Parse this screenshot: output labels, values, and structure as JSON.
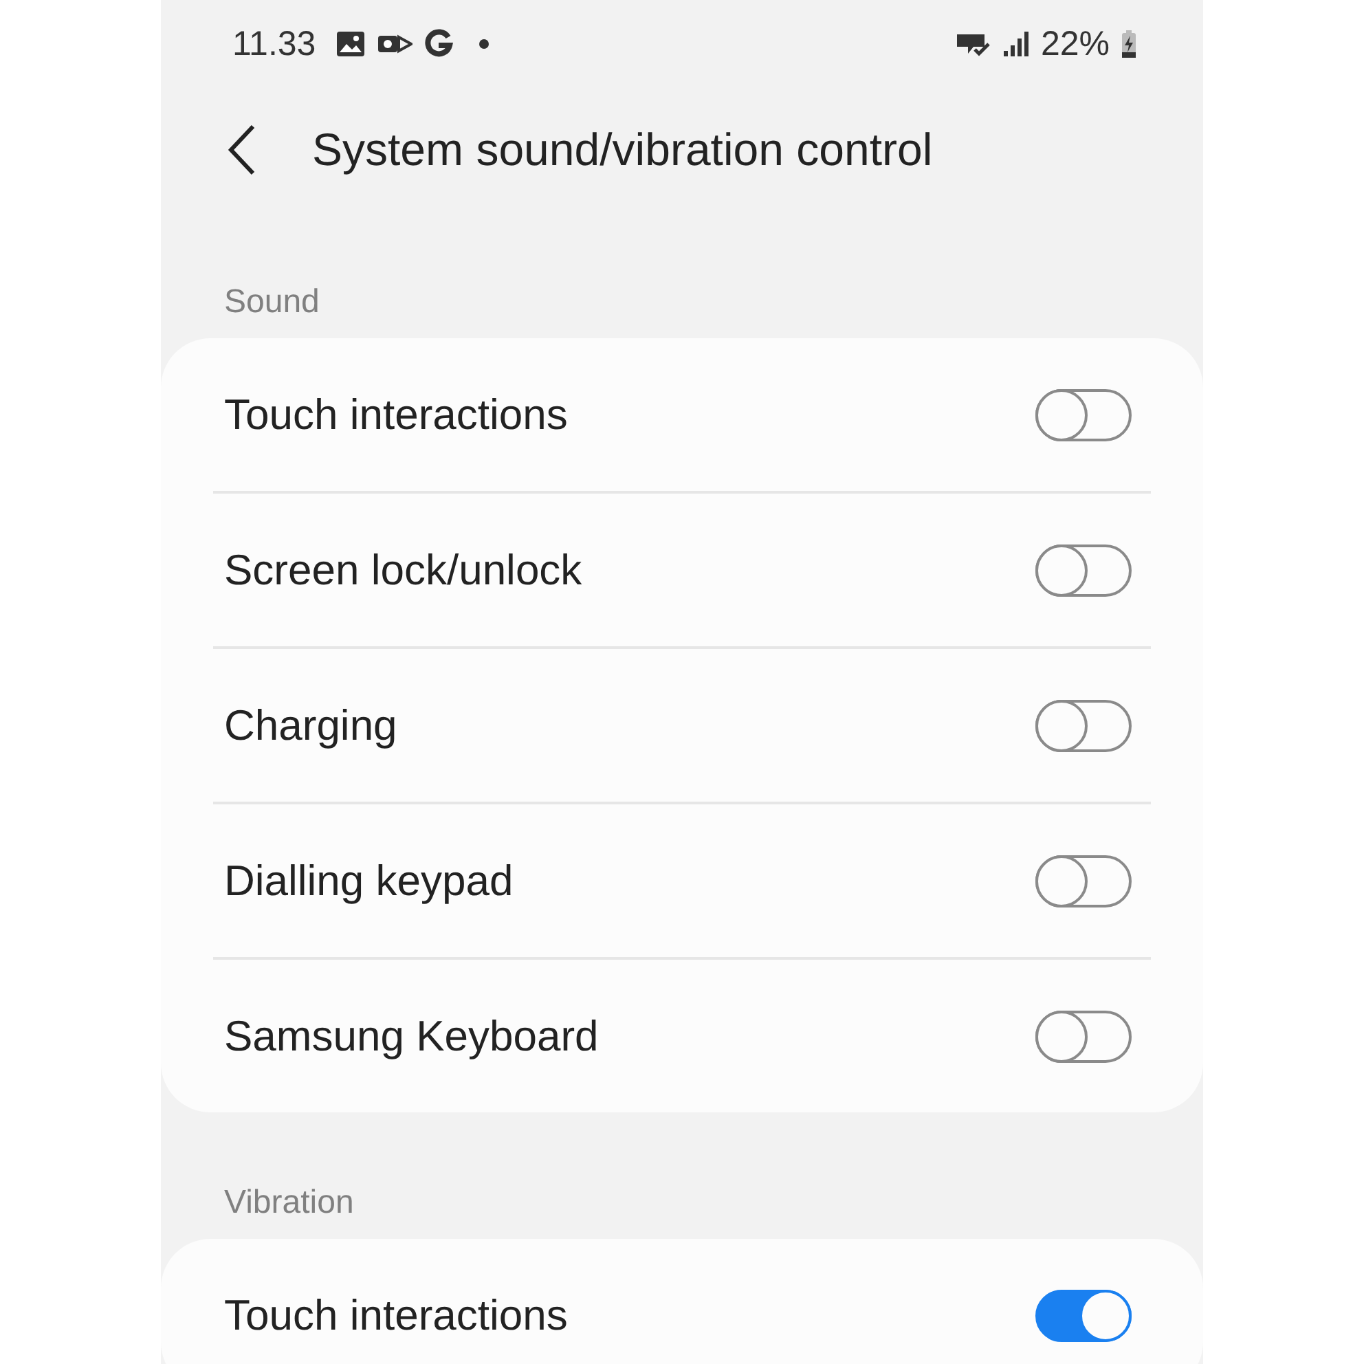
{
  "status_bar": {
    "time": "11.33",
    "battery": "22%"
  },
  "header": {
    "title": "System sound/vibration control"
  },
  "sections": [
    {
      "title": "Sound",
      "items": [
        {
          "label": "Touch interactions",
          "on": false
        },
        {
          "label": "Screen lock/unlock",
          "on": false
        },
        {
          "label": "Charging",
          "on": false
        },
        {
          "label": "Dialling keypad",
          "on": false
        },
        {
          "label": "Samsung Keyboard",
          "on": false
        }
      ]
    },
    {
      "title": "Vibration",
      "items": [
        {
          "label": "Touch interactions",
          "on": true
        }
      ]
    }
  ]
}
